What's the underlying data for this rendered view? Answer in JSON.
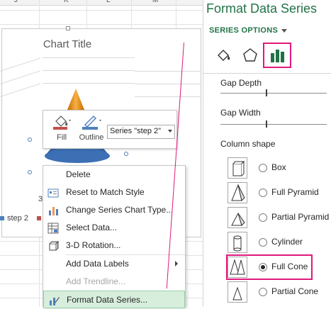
{
  "sheet": {
    "col_headers": [
      "J",
      "K",
      "L",
      "M"
    ]
  },
  "chart": {
    "title": "Chart Title",
    "legend": {
      "items": [
        {
          "label": "step 2",
          "color": "#4f81bd"
        },
        {
          "label": "",
          "color": "#c0504d"
        }
      ],
      "partial_label": "3"
    },
    "cone_colors": {
      "top": "#f39c12",
      "bottom": "#3d6fb5"
    }
  },
  "mini_toolbar": {
    "fill_label": "Fill",
    "outline_label": "Outline",
    "series_select_value": "Series \"step 2\""
  },
  "context_menu": {
    "items": [
      {
        "label": "Delete",
        "icon": "none",
        "disabled": false
      },
      {
        "label": "Reset to Match Style",
        "icon": "reset-style-icon",
        "disabled": false
      },
      {
        "label": "Change Series Chart Type...",
        "icon": "chart-type-icon",
        "disabled": false
      },
      {
        "label": "Select Data...",
        "icon": "select-data-icon",
        "disabled": false
      },
      {
        "label": "3-D Rotation...",
        "icon": "rotation-icon",
        "disabled": false
      },
      {
        "label": "Add Data Labels",
        "icon": "none",
        "disabled": false,
        "submenu": true
      },
      {
        "label": "Add Trendline...",
        "icon": "none",
        "disabled": true
      },
      {
        "label": "Format Data Series...",
        "icon": "format-series-icon",
        "disabled": false,
        "highlighted": true
      }
    ]
  },
  "pane": {
    "title": "Format Data Series",
    "section": "SERIES OPTIONS",
    "tabs": [
      {
        "name": "fill-line-icon"
      },
      {
        "name": "effects-pentagon-icon"
      },
      {
        "name": "series-options-bars-icon",
        "active": true
      }
    ],
    "gap_depth_label": "Gap Depth",
    "gap_width_label": "Gap Width",
    "column_shape_label": "Column shape",
    "shapes": [
      {
        "label": "Box",
        "selected": false
      },
      {
        "label": "Full Pyramid",
        "selected": false
      },
      {
        "label": "Partial Pyramid",
        "selected": false
      },
      {
        "label": "Cylinder",
        "selected": false
      },
      {
        "label": "Full Cone",
        "selected": true
      },
      {
        "label": "Partial Cone",
        "selected": false
      }
    ]
  },
  "accent_color": "#e0197e",
  "excel_green": "#217346"
}
